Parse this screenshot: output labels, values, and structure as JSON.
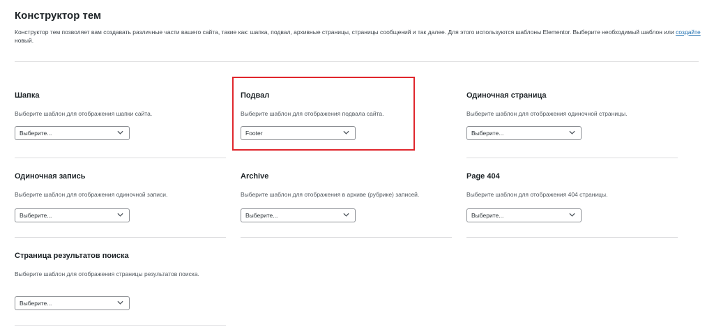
{
  "header": {
    "title": "Конструктор тем",
    "description_part1": "Конструктор тем позволяет вам создавать различные части вашего сайта, такие как: шапка, подвал, архивные страницы, страницы сообщений и так далее. Для этого используются шаблоны Elementor. Выберите необходимый шаблон или ",
    "create_link": "создайте",
    "description_part2": " новый."
  },
  "cards": {
    "header": {
      "title": "Шапка",
      "description": "Выберите шаблон для отображения шапки сайта.",
      "selected": "Выберите..."
    },
    "footer": {
      "title": "Подвал",
      "description": "Выберите шаблон для отображения подвала сайта.",
      "selected": "Footer"
    },
    "single_page": {
      "title": "Одиночная страница",
      "description": "Выберите шаблон для отображения одиночной страницы.",
      "selected": "Выберите..."
    },
    "single_post": {
      "title": "Одиночная запись",
      "description": "Выберите шаблон для отображения одиночной записи.",
      "selected": "Выберите..."
    },
    "archive": {
      "title": "Archive",
      "description": "Выберите шаблон для отображения в архиве (рубрике) записей.",
      "selected": "Выберите..."
    },
    "page_404": {
      "title": "Page 404",
      "description": "Выберите шаблон для отображения 404 страницы.",
      "selected": "Выберите..."
    },
    "search_results": {
      "title": "Страница результатов поиска",
      "description": "Выберите шаблон для отображения страницы результатов поиска.",
      "selected": "Выберите..."
    }
  },
  "colors": {
    "link": "#2271b1",
    "highlight": "#e0262c",
    "divider": "#dcdcde"
  }
}
